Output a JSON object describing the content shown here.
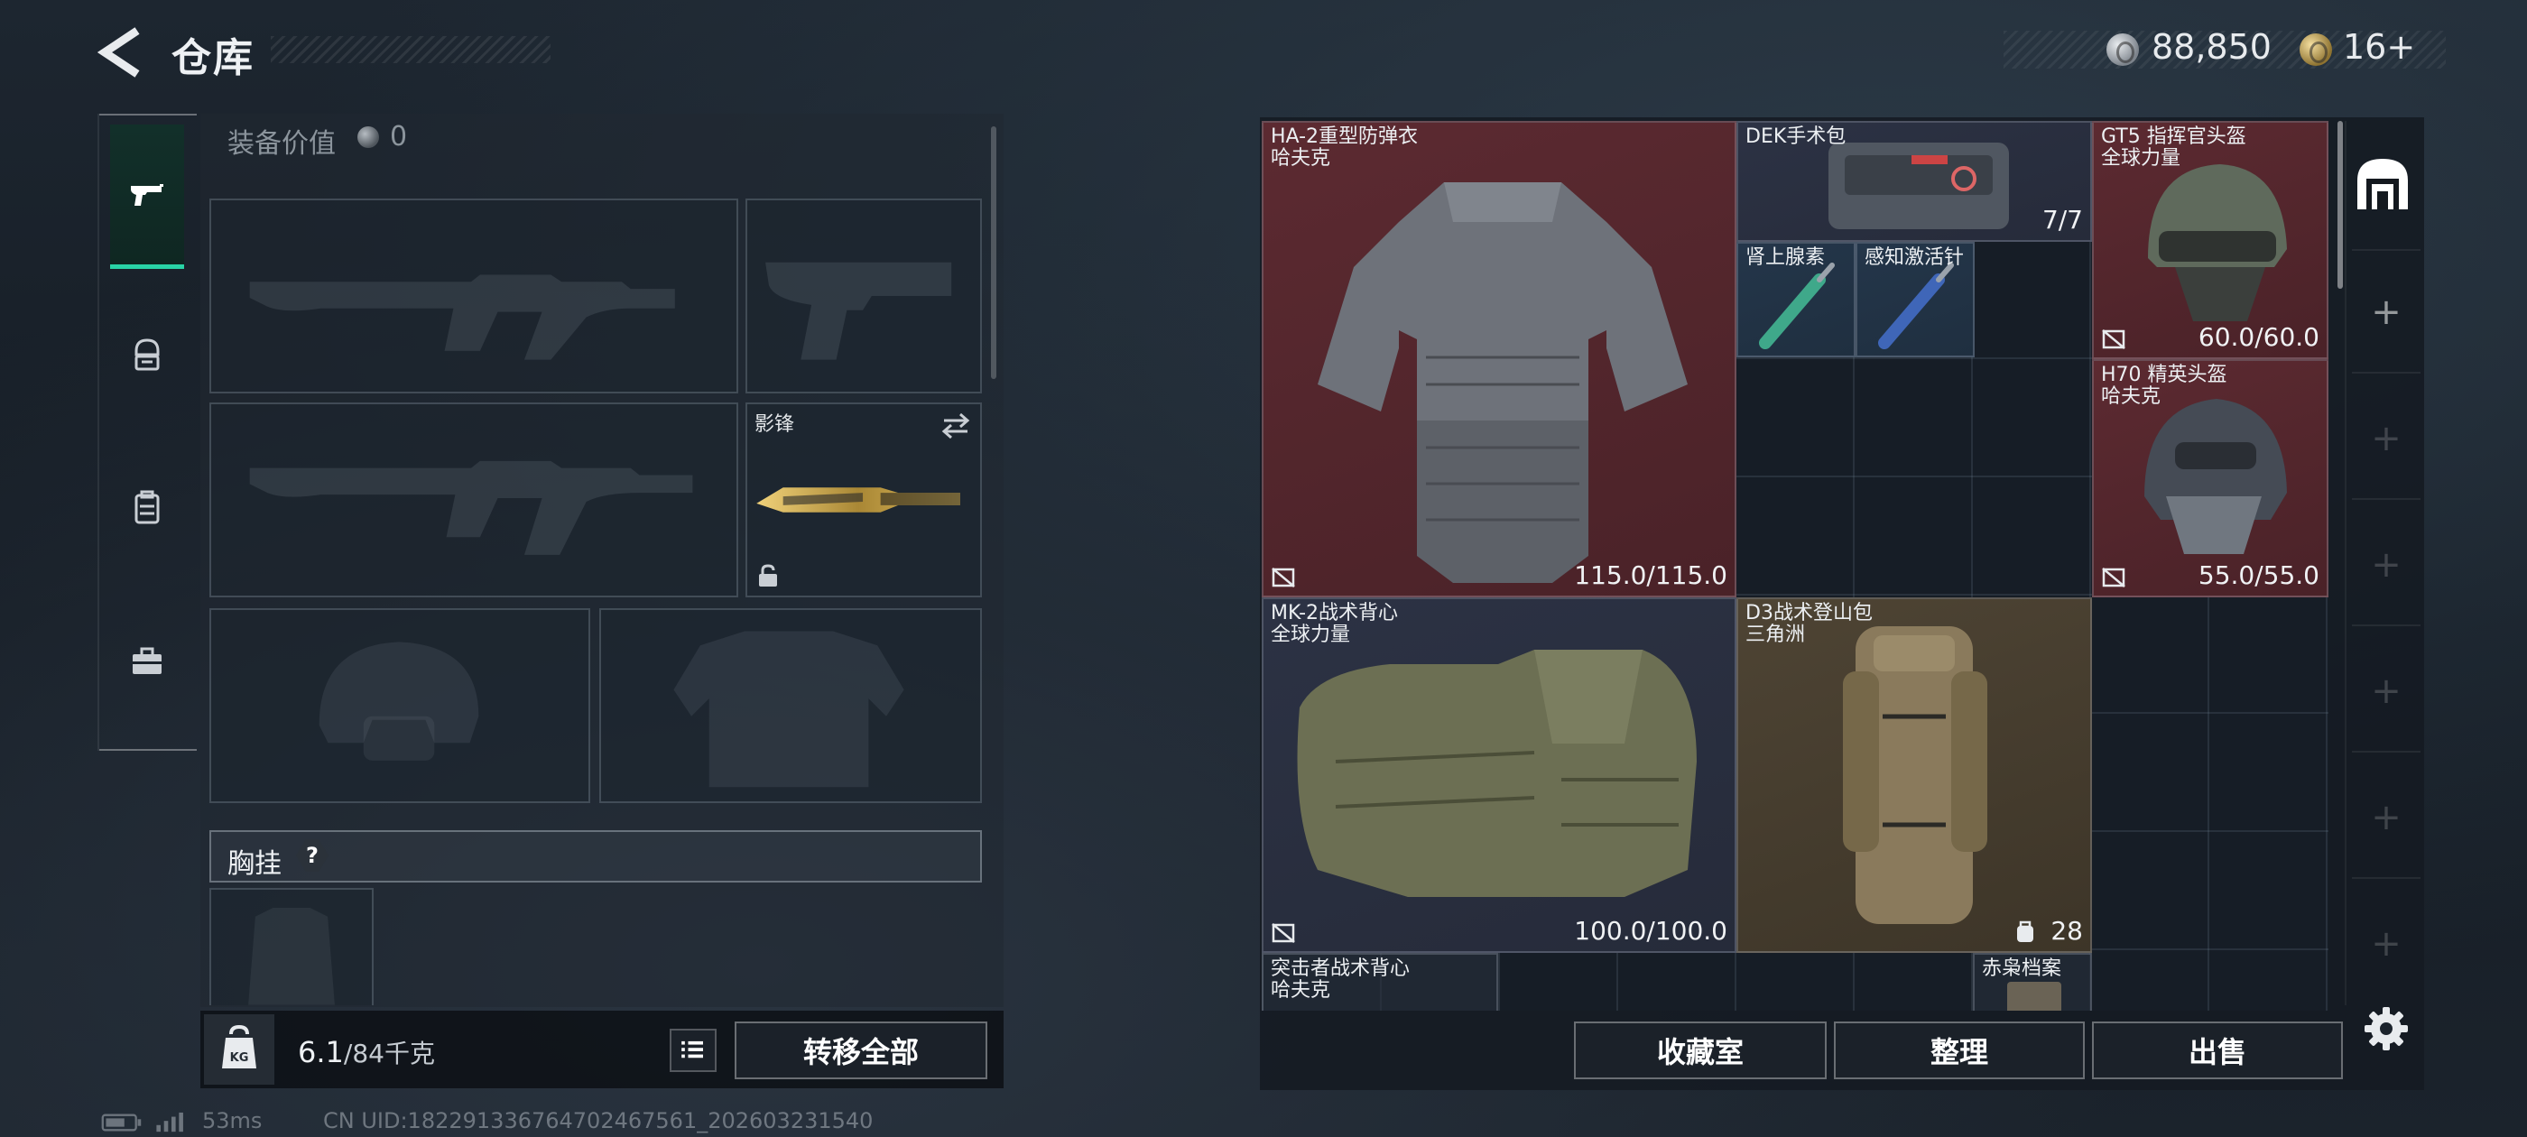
{
  "header": {
    "title": "仓库"
  },
  "currencies": [
    {
      "icon": "silver-coin-icon",
      "value": "88,850"
    },
    {
      "icon": "gold-coin-icon",
      "value": "16+"
    }
  ],
  "left_panel": {
    "equip_value_label": "装备价值",
    "equip_value": "0",
    "nav_tabs": [
      {
        "icon": "pistol-icon",
        "active": true
      },
      {
        "icon": "helmet-armor-icon",
        "active": false
      },
      {
        "icon": "backpack-icon",
        "active": false
      },
      {
        "icon": "toolbox-icon",
        "active": false
      }
    ],
    "melee_slot_label": "影锋",
    "chest_rig_label": "胸挂",
    "help_symbol": "?",
    "weight_current": "6.1",
    "weight_max": "/84千克",
    "transfer_all": "转移全部"
  },
  "stash": {
    "items": [
      {
        "name": "HA-2重型防弹衣",
        "brand": "哈夫克",
        "durability": "115.0/115.0",
        "color": "red",
        "icon": "body-armor-icon"
      },
      {
        "name": "DEK手术包",
        "count": "7/7",
        "color": "navy",
        "icon": "surgery-kit-icon"
      },
      {
        "name": "肾上腺素",
        "color": "blue",
        "icon": "syringe-icon"
      },
      {
        "name": "感知激活针",
        "color": "blue",
        "icon": "syringe-icon"
      },
      {
        "name": "GT5 指挥官头盔",
        "brand": "全球力量",
        "durability": "60.0/60.0",
        "color": "red",
        "icon": "helmet-icon"
      },
      {
        "name": "H70 精英头盔",
        "brand": "哈夫克",
        "durability": "55.0/55.0",
        "color": "red",
        "icon": "helmet-icon"
      },
      {
        "name": "MK-2战术背心",
        "brand": "全球力量",
        "durability": "100.0/100.0",
        "color": "navy",
        "icon": "tactical-vest-icon"
      },
      {
        "name": "D3战术登山包",
        "brand": "三角洲",
        "capacity": "28",
        "color": "tan",
        "icon": "backpack-icon"
      },
      {
        "name": "突击者战术背心",
        "brand": "哈夫克",
        "color": "plain",
        "icon": "tactical-vest-icon"
      },
      {
        "name": "赤枭档案",
        "color": "plain",
        "icon": "document-icon"
      }
    ],
    "buttons": {
      "collection": "收藏室",
      "organize": "整理",
      "sell": "出售"
    }
  },
  "status_bar": {
    "ping": "53ms",
    "uid": "CN UID:182291336764702467561_202603231540"
  }
}
